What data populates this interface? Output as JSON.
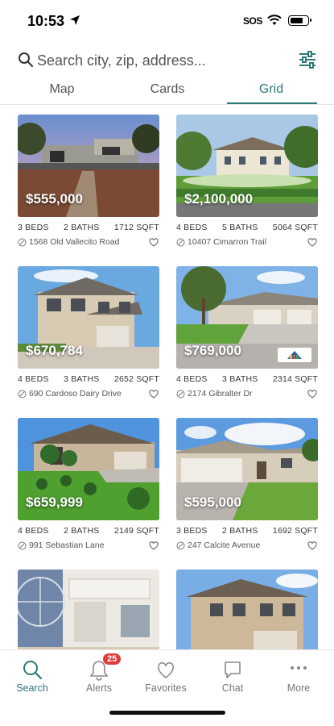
{
  "status": {
    "time": "10:53",
    "carrier": "SOS"
  },
  "search": {
    "placeholder": "Search city, zip, address..."
  },
  "tabs": [
    {
      "label": "Map"
    },
    {
      "label": "Cards"
    },
    {
      "label": "Grid",
      "active": true
    }
  ],
  "listings": [
    {
      "price": "$555,000",
      "beds": "3 BEDS",
      "baths": "2 BATHS",
      "sqft": "1712 SQFT",
      "address": "1568 Old Vallecito Road"
    },
    {
      "price": "$2,100,000",
      "beds": "4 BEDS",
      "baths": "5 BATHS",
      "sqft": "5064 SQFT",
      "address": "10407 Cimarron Trail"
    },
    {
      "price": "$670,784",
      "beds": "4 BEDS",
      "baths": "3 BATHS",
      "sqft": "2652 SQFT",
      "address": "690 Cardoso Dairy Drive"
    },
    {
      "price": "$769,000",
      "beds": "4 BEDS",
      "baths": "3 BATHS",
      "sqft": "2314 SQFT",
      "address": "2174 Gibralter Dr"
    },
    {
      "price": "$659,999",
      "beds": "4 BEDS",
      "baths": "2 BATHS",
      "sqft": "2149 SQFT",
      "address": "991 Sebastian Lane"
    },
    {
      "price": "$595,000",
      "beds": "3 BEDS",
      "baths": "2 BATHS",
      "sqft": "1692 SQFT",
      "address": "247 Calcite Avenue"
    }
  ],
  "nav": {
    "search": "Search",
    "alerts": "Alerts",
    "alerts_badge": "25",
    "favorites": "Favorites",
    "chat": "Chat",
    "more": "More"
  },
  "colors": {
    "accent": "#2b7a78",
    "badge": "#e23b3b"
  }
}
